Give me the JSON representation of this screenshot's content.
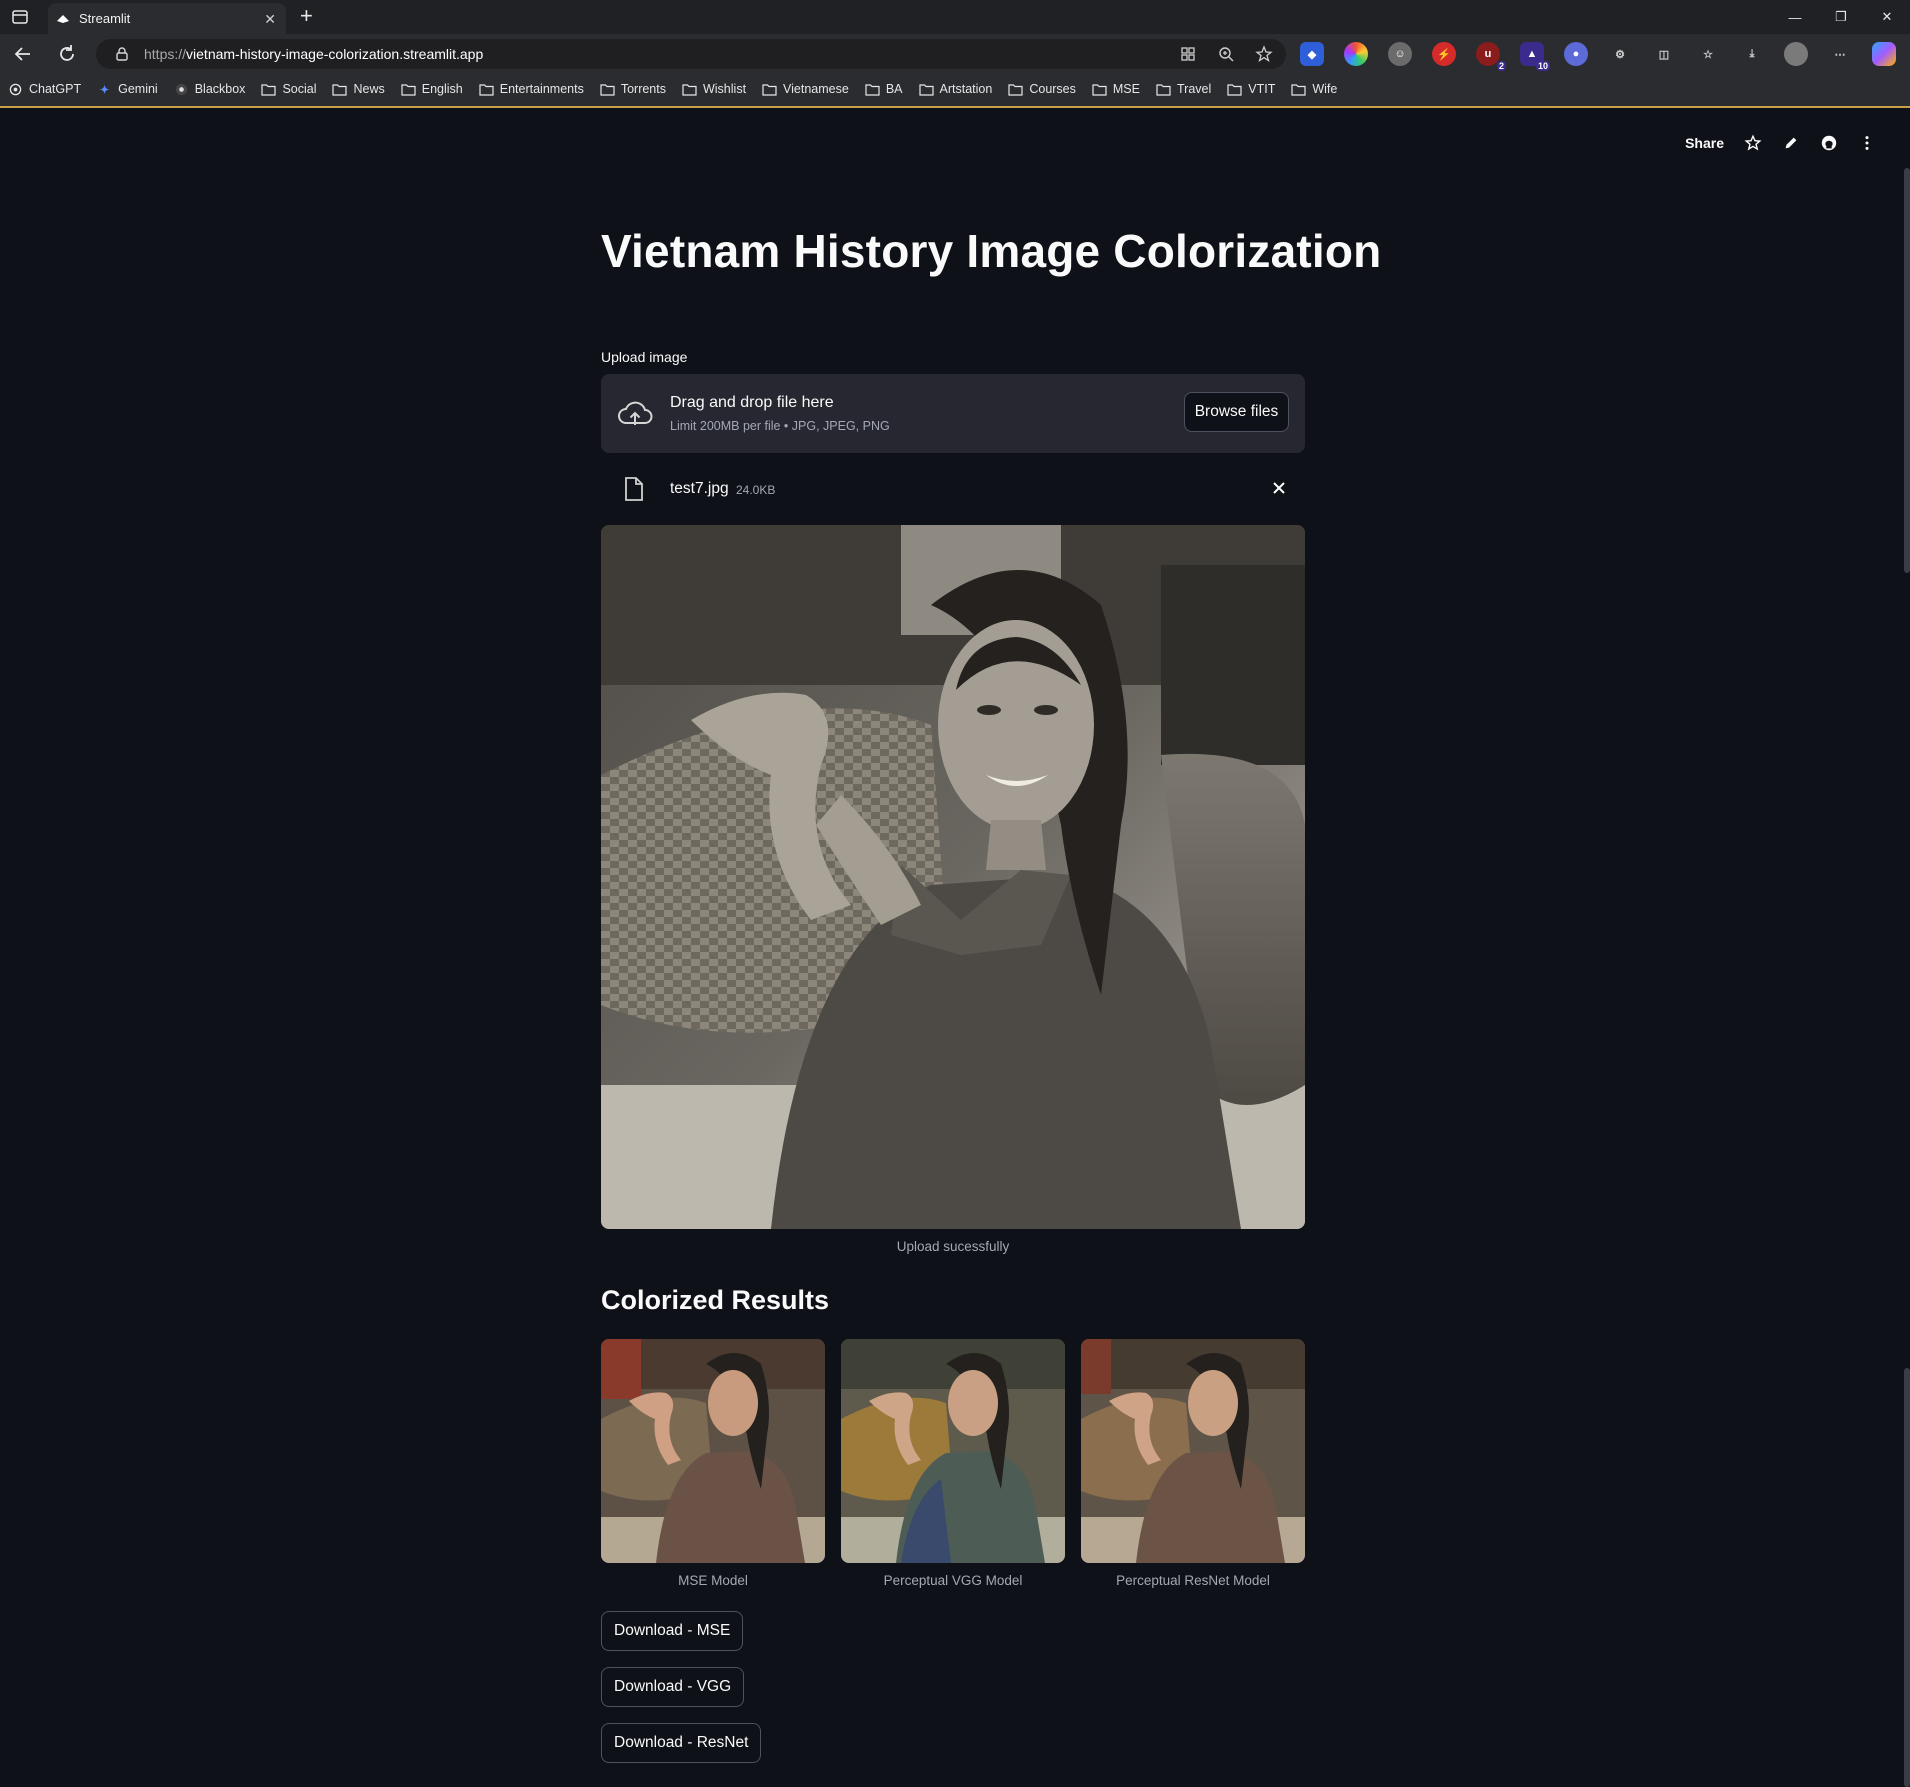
{
  "browser": {
    "tab_title": "Streamlit",
    "url_scheme": "https://",
    "url_host": "vietnam-history-image-colorization.streamlit.app",
    "bookmarks": [
      "ChatGPT",
      "Gemini",
      "Blackbox",
      "Social",
      "News",
      "English",
      "Entertainments",
      "Torrents",
      "Wishlist",
      "Vietnamese",
      "BA",
      "Artstation",
      "Courses",
      "MSE",
      "Travel",
      "VTIT",
      "Wife"
    ],
    "ext_badges": [
      "2",
      "10"
    ],
    "accent_color": "#c8a04a"
  },
  "header": {
    "share_label": "Share"
  },
  "app": {
    "title": "Vietnam History Image Colorization",
    "upload_label": "Upload image",
    "dropzone_main": "Drag and drop file here",
    "dropzone_sub": "Limit 200MB per file • JPG, JPEG, PNG",
    "browse_label": "Browse files",
    "file_name": "test7.jpg",
    "file_size": "24.0KB",
    "upload_caption": "Upload sucessfully",
    "results_title": "Colorized Results",
    "results": [
      {
        "caption": "MSE Model"
      },
      {
        "caption": "Perceptual VGG Model"
      },
      {
        "caption": "Perceptual ResNet Model"
      }
    ],
    "downloads": [
      "Download - MSE",
      "Download - VGG",
      "Download - ResNet"
    ]
  },
  "colors": {
    "background": "#0e1117",
    "surface": "#262730",
    "text": "#fafafa",
    "muted_text": "#a3a8b4"
  }
}
